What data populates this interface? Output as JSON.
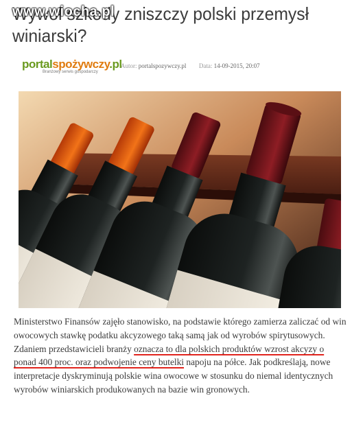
{
  "watermark": "www.wiocha.pl",
  "headline": "Wywoł szkody zniszczy polski przemysł winiarski?",
  "source_logo": {
    "main_part1": "portal",
    "main_part2": "spożywczy",
    "main_part3": ".pl",
    "tagline": "Branżowy serwis gospodarczy"
  },
  "meta": {
    "author_label": "Autor:",
    "author_value": "portalspozywczy.pl",
    "date_label": "Data:",
    "date_value": "14-09-2015, 20:07"
  },
  "image": {
    "description_icon": "wine-bottles-photo"
  },
  "body": {
    "part1": "Ministerstwo Finansów zajęło stanowisko, na podstawie którego zamierza zaliczać od win owocowych stawkę podatku akcyzowego taką samą jak od wyrobów spirytusowych. Zdaniem przedstawicieli branży ",
    "highlight1": "oznacza to dla polskich produktów wzrost akcyzy o ponad 400 proc. oraz podwojenie ceny butelki",
    "part2": " napoju na półce. Jak podkreślają, nowe interpretacje dyskryminują polskie wina owocowe w stosunku do niemal identycznych wyrobów winiarskich produkowanych na bazie win gronowych."
  },
  "colors": {
    "headline": "#3b3b3b",
    "logo_green": "#6a9a1f",
    "logo_orange": "#e07c10",
    "underline_red": "#e0231c"
  }
}
